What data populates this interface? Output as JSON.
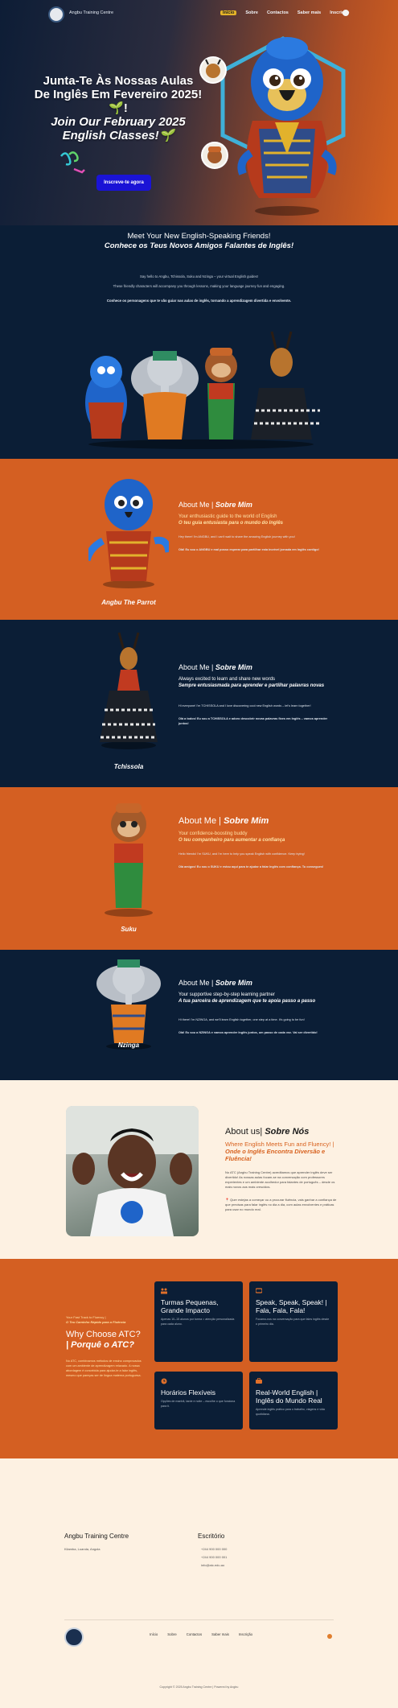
{
  "nav": {
    "brand": "Angbu Training Centre",
    "items": [
      {
        "label": "Início",
        "active": true
      },
      {
        "label": "Sobre"
      },
      {
        "label": "Contactos"
      },
      {
        "label": "Saber mais"
      },
      {
        "label": "Inscrição"
      }
    ]
  },
  "hero": {
    "title_pt": "Junta-Te Às Nossas Aulas De Inglês Em Fevereiro 2025!🌱!",
    "title_en": "Join Our February 2025 English Classes!🌱",
    "cta": "Inscreve-te agora"
  },
  "meet": {
    "title_en": "Meet Your New English-Speaking Friends!",
    "title_pt": "Conhece os Teus Novos Amigos Falantes de Inglês!",
    "p1": "Say hello to Angbu, Tchissola, Suku and Nzinga – your virtual English guides!",
    "p2": "These friendly characters will accompany you through lessons, making your language journey fun and engaging.",
    "p3": "Conhece os personagens que te vão guiar nas aulas de inglês, tornando a aprendizagem divertida e envolvente."
  },
  "characters": [
    {
      "name": "Angbu The Parrot",
      "about_en": "About Me | ",
      "about_pt": "Sobre Mim",
      "sub_en": "Your enthusiastic guide to the world of English",
      "sub_pt": "O teu guia entusiasta para o mundo do Inglês",
      "p_en": "Hey there! I'm ANGBU, and I can't wait to share the amazing English journey with you!",
      "p_pt": "Olá! Eu sou o ANGBU e mal posso esperar para partilhar esta incrível jornada em Inglês contigo!"
    },
    {
      "name": "Tchissola",
      "about_en": "About Me | ",
      "about_pt": "Sobre Mim",
      "sub_en": "Always excited to learn and share new words",
      "sub_pt": "Sempre entusiasmada para aprender e partilhar palavras novas",
      "p_en": "Hi everyone! I'm TCHISSOLA and I love discovering cool new English words – let's learn together!",
      "p_pt": "Olá a todos! Eu sou a TCHISSOLA e adoro descobrir novas palavras fixes em Inglês – vamos aprender juntos!"
    },
    {
      "name": "Suku",
      "about_en": "About Me | ",
      "about_pt": "Sobre Mim",
      "sub_en": "Your confidence-boosting buddy",
      "sub_pt": "O teu companheiro para aumentar a confiança",
      "p_en": "Hello friends! I'm SUKU, and I'm here to help you speak English with confidence. Keep trying!",
      "p_pt": "Olá amigos! Eu sou o SUKU e estou aqui para te ajudar a falar Inglês com confiança. Tu consegues!"
    },
    {
      "name": "Nzinga",
      "about_en": "About Me | ",
      "about_pt": "Sobre Mim",
      "sub_en": "Your supportive step-by-step learning partner",
      "sub_pt": "A tua parceira de aprendizagem que te apoia passo a passo",
      "p_en": "Hi there! I'm NZINGA, and we'll learn English together, one step at a time. It's going to be fun!",
      "p_pt": "Olá! Eu sou a NZINGA e vamos aprender Inglês juntos, um passo de cada vez. Vai ser divertido!"
    }
  ],
  "about_us": {
    "title_en": "About us| ",
    "title_pt": "Sobre Nós",
    "sub_en": "Where English Meets Fun and Fluency! | ",
    "sub_pt": "Onde o Inglês Encontra Diversão e Fluência!",
    "p1": "No ATC (Angbu Training Centre) acreditamos que aprender inglês deve ser divertido! As nossas aulas focam-se na conversação com professores experientes e um ambiente acolhedor para falantes de português – desde os mais novos aos mais crescidos.",
    "p2": "📍 Quer estejas a começar ou a procurar fluência, vais ganhar a confiança de que precisas para falar inglês no dia a dia, com aulas envolventes e práticas para usar no mundo real."
  },
  "why": {
    "kicker_en": "Your Fast Track to Fluency |",
    "kicker_pt": "O Teu Caminho Rápido para a Fluência",
    "title_en": "Why Choose ATC?",
    "title_pt": "| Porquê o ATC?",
    "p": "No ATC, combinamos métodos de ensino comprovados com um ambiente de aprendizagem relaxado. A nossa abordagem é concebida para ajudar-te a falar inglês, mesmo que pareças ser de língua materna portuguesa.",
    "cards": [
      {
        "title": "Turmas Pequenas, Grande Impacto",
        "desc": "Apenas 10–15 alunos por turma = atenção personalizada para cada aluno."
      },
      {
        "title": "Speak, Speak, Speak! | Fala, Fala, Fala!",
        "desc": "Focamo-nos na conversação para que fales inglês desde o primeiro dia."
      },
      {
        "title": "Horários Flexíveis",
        "desc": "Opções de manhã, tarde e noite – escolhe o que funciona para ti."
      },
      {
        "title": "Real-World English | Inglês do Mundo Real",
        "desc": "Aprende inglês prático para o trabalho, viagens e vida quotidiana."
      }
    ]
  },
  "footer": {
    "col1_title": "Angbu Training Centre",
    "col1_text": "Kilamba, Luanda, Angola",
    "col2_title": "Escritório",
    "phone1": "+244 900 000 000",
    "phone2": "+244 900 000 001",
    "email": "info@atc.edu.ao",
    "menu": [
      "Início",
      "Sobre",
      "Contactos",
      "Saber mais",
      "Inscrição"
    ],
    "copyright": "Copyright © 2025 Angbu Training Centre | Powered by Angbu"
  }
}
